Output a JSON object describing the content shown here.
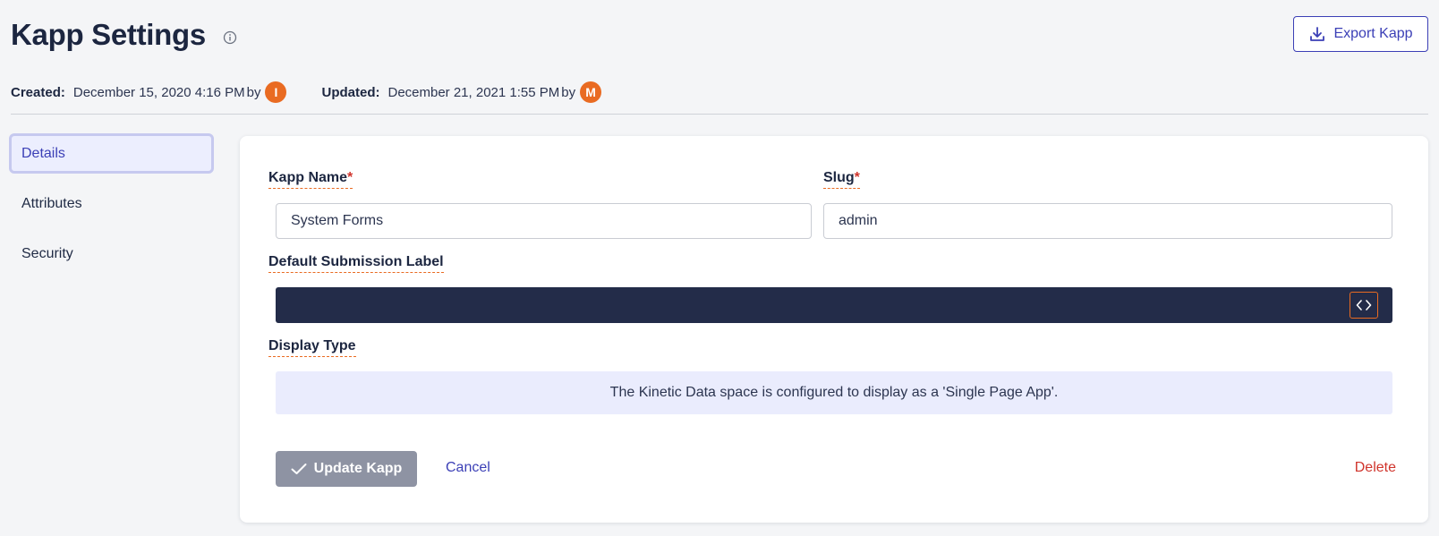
{
  "header": {
    "title": "Kapp Settings",
    "export_label": "Export Kapp"
  },
  "meta": {
    "created_label": "Created:",
    "created_value": "December 15, 2020 4:16 PM",
    "created_by_word": "by",
    "created_by_initial": "I",
    "updated_label": "Updated:",
    "updated_value": "December 21, 2021 1:55 PM",
    "updated_by_word": "by",
    "updated_by_initial": "M"
  },
  "sidebar": {
    "items": [
      {
        "label": "Details",
        "active": true
      },
      {
        "label": "Attributes",
        "active": false
      },
      {
        "label": "Security",
        "active": false
      }
    ]
  },
  "form": {
    "kapp_name_label": "Kapp Name",
    "kapp_name_value": "System Forms",
    "slug_label": "Slug",
    "slug_value": "admin",
    "required_mark": "*",
    "submission_label_label": "Default Submission Label",
    "display_type_label": "Display Type",
    "display_type_notice": "The Kinetic Data space is configured to display as a 'Single Page App'.",
    "update_label": "Update Kapp",
    "cancel_label": "Cancel",
    "delete_label": "Delete"
  },
  "colors": {
    "accent": "#3b3fb6",
    "avatar": "#e96b22",
    "danger": "#d0342c",
    "code_bg": "#232c49"
  },
  "icons": [
    "info-icon",
    "download-icon",
    "code-icon",
    "check-icon"
  ]
}
